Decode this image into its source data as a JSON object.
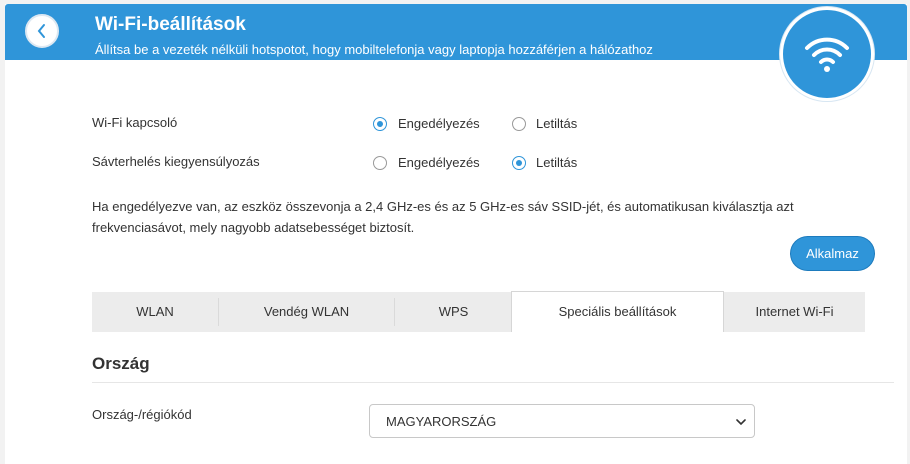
{
  "header": {
    "title": "Wi-Fi-beállítások",
    "subtitle": "Állítsa be a vezeték nélküli hotspotot, hogy mobiltelefonja vagy laptopja hozzáférjen a hálózathoz",
    "color": "#2f95d9"
  },
  "settings": {
    "wifi_switch": {
      "label": "Wi-Fi kapcsoló",
      "enable_label": "Engedélyezés",
      "disable_label": "Letiltás",
      "selected": "enable"
    },
    "band_balance": {
      "label": "Sávterhelés kiegyensúlyozás",
      "enable_label": "Engedélyezés",
      "disable_label": "Letiltás",
      "selected": "disable"
    },
    "description": "Ha engedélyezve van, az eszköz összevonja a 2,4 GHz-es és az 5 GHz-es sáv SSID-jét, és automatikusan kiválasztja azt frekvenciasávot, mely nagyobb adatsebességet biztosít.",
    "apply_label": "Alkalmaz"
  },
  "tabs": [
    {
      "label": "WLAN"
    },
    {
      "label": "Vendég WLAN"
    },
    {
      "label": "WPS"
    },
    {
      "label": "Speciális beállítások",
      "active": true
    },
    {
      "label": "Internet Wi-Fi"
    }
  ],
  "country": {
    "section_title": "Ország",
    "field_label": "Ország-/régiókód",
    "selected_value": "MAGYARORSZÁG"
  },
  "icons": [
    "back-chevron-icon",
    "wifi-icon",
    "select-chevron-icon"
  ]
}
